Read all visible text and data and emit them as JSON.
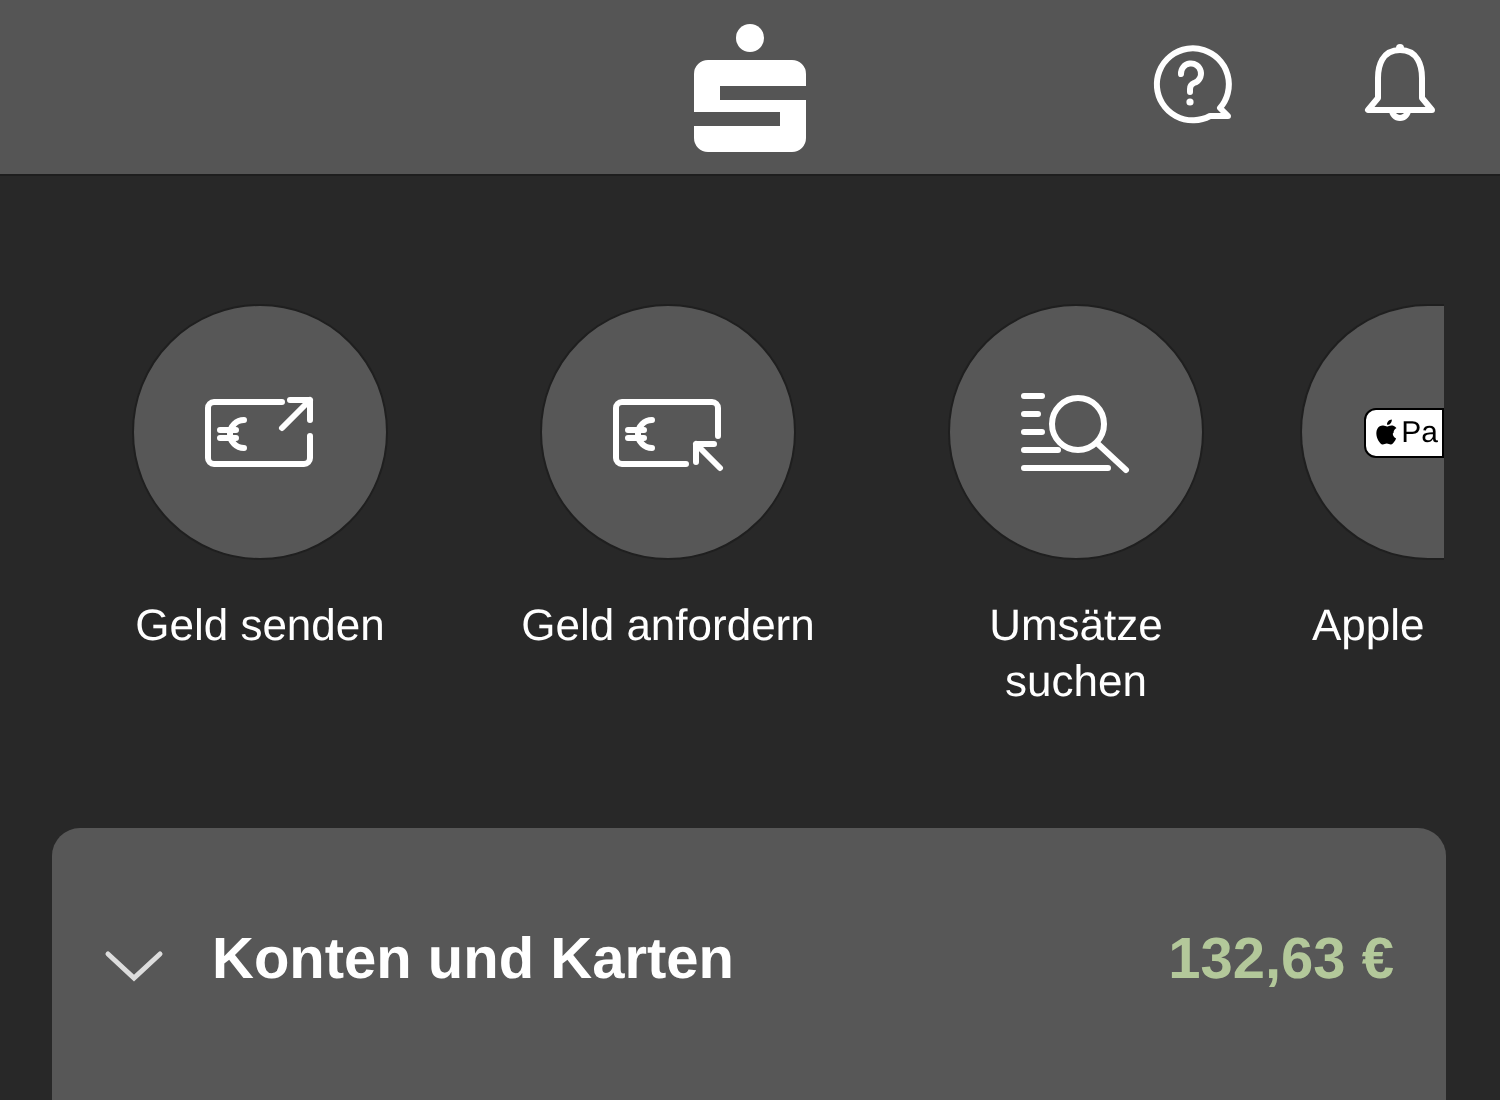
{
  "actions": [
    {
      "kind": "send",
      "label": "Geld senden"
    },
    {
      "kind": "request",
      "label": "Geld anfordern"
    },
    {
      "kind": "search",
      "label": "Umsätze suchen"
    },
    {
      "kind": "wallet",
      "label": "Apple",
      "badge": "Pa"
    }
  ],
  "accounts_card": {
    "title": "Konten und Karten",
    "balance": "132,63 €"
  }
}
